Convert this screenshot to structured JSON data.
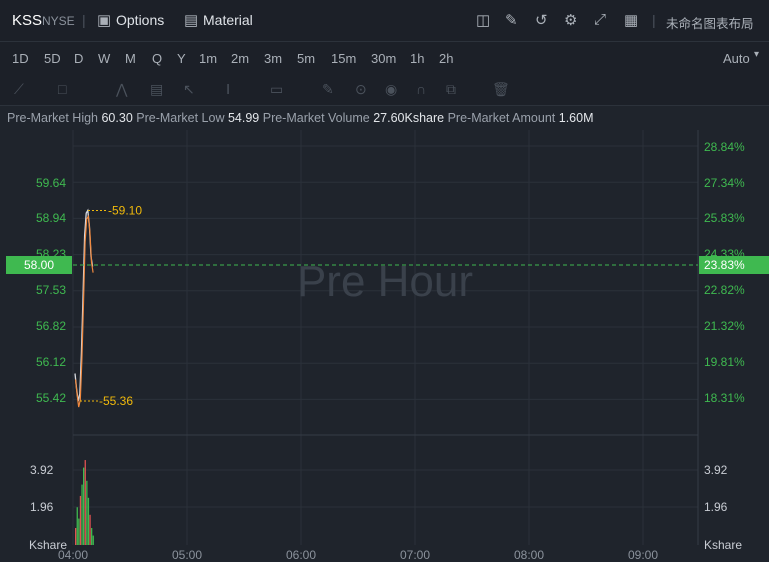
{
  "header": {
    "symbol": "KSS",
    "exchange": "NYSE",
    "options_label": "Options",
    "material_label": "Material",
    "layout_name": "未命名图表布局"
  },
  "timeframes": [
    "1D",
    "5D",
    "D",
    "W",
    "M",
    "Q",
    "Y",
    "1m",
    "2m",
    "3m",
    "5m",
    "15m",
    "30m",
    "1h",
    "2h"
  ],
  "active_timeframe": "1D",
  "scale_mode": "Auto",
  "premarket": {
    "high_label": "Pre-Market High",
    "high_value": "60.30",
    "low_label": "Pre-Market Low",
    "low_value": "54.99",
    "volume_label": "Pre-Market Volume",
    "volume_value": "27.60Kshare",
    "amount_label": "Pre-Market Amount",
    "amount_value": "1.60M"
  },
  "watermark": "Pre Hour",
  "colors": {
    "up": "#3fb950",
    "down": "#e05252",
    "accent": "#f0b90b",
    "price_line": "#f0883e",
    "bg": "#1f242c"
  },
  "chart_data": {
    "type": "line",
    "price_axis_left": [
      "59.64",
      "58.94",
      "58.23",
      "57.53",
      "56.82",
      "56.12",
      "55.42"
    ],
    "percent_axis_right": [
      "28.84%",
      "27.34%",
      "25.83%",
      "24.33%",
      "22.82%",
      "21.32%",
      "19.81%",
      "18.31%"
    ],
    "current_price": "58.00",
    "current_percent": "23.83%",
    "high_marker": "59.10",
    "low_marker": "55.36",
    "ylim": [
      54.8,
      60.2
    ],
    "x_ticks": [
      "04:00",
      "05:00",
      "06:00",
      "07:00",
      "08:00",
      "09:00"
    ],
    "volume_axis": [
      "3.92",
      "1.96"
    ],
    "volume_unit": "Kshare",
    "series": [
      {
        "x": [
          0,
          1,
          2,
          3,
          4,
          5,
          6,
          7,
          8,
          9,
          10,
          11
        ],
        "values": [
          55.9,
          55.6,
          55.36,
          55.5,
          56.3,
          57.4,
          58.6,
          59.05,
          59.1,
          58.8,
          58.2,
          58.0
        ]
      }
    ],
    "volume": [
      0.9,
      2.0,
      1.4,
      2.6,
      3.2,
      4.1,
      4.5,
      3.4,
      2.5,
      1.6,
      0.9,
      0.5
    ]
  }
}
